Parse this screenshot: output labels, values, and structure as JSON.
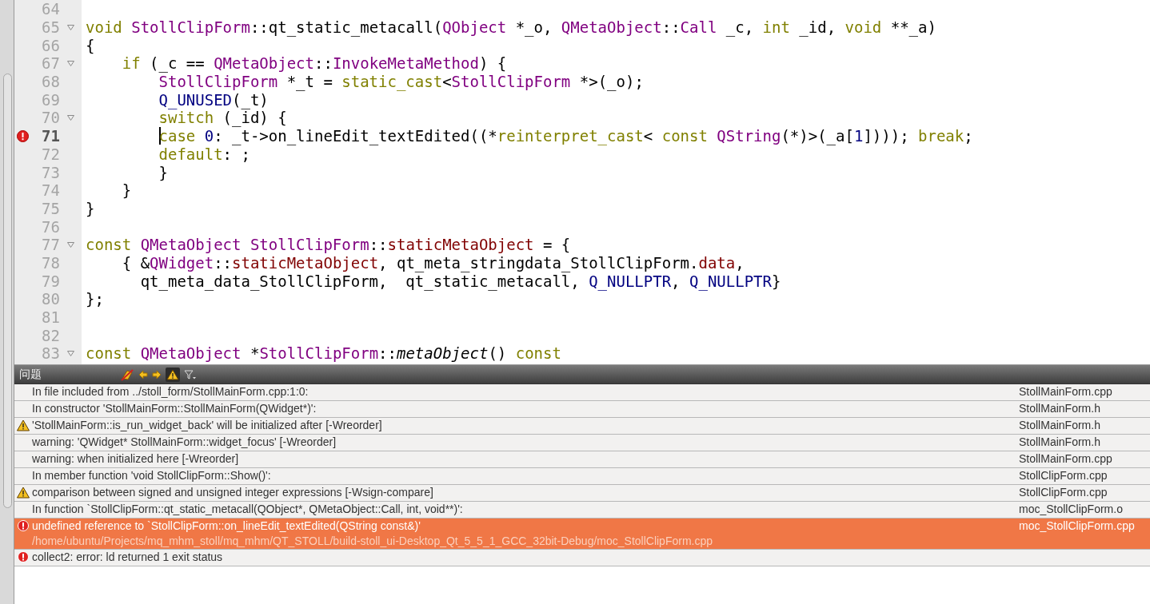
{
  "editor": {
    "lines": [
      {
        "number": "64"
      },
      {
        "number": "65",
        "fold": true,
        "tokens": [
          {
            "kind": "keyword",
            "text": "void "
          },
          {
            "kind": "type",
            "text": "StollClipForm"
          },
          {
            "kind": "plain",
            "text": "::qt_static_metacall("
          },
          {
            "kind": "type",
            "text": "QObject"
          },
          {
            "kind": "plain",
            "text": " *_o, "
          },
          {
            "kind": "type",
            "text": "QMetaObject"
          },
          {
            "kind": "plain",
            "text": "::"
          },
          {
            "kind": "type",
            "text": "Call"
          },
          {
            "kind": "plain",
            "text": " _c, "
          },
          {
            "kind": "keyword",
            "text": "int"
          },
          {
            "kind": "plain",
            "text": " _id, "
          },
          {
            "kind": "keyword",
            "text": "void"
          },
          {
            "kind": "plain",
            "text": " **_a)"
          }
        ]
      },
      {
        "number": "66",
        "tokens": [
          {
            "kind": "plain",
            "text": "{"
          }
        ]
      },
      {
        "number": "67",
        "fold": true,
        "tokens": [
          {
            "kind": "keyword",
            "text": "    if"
          },
          {
            "kind": "plain",
            "text": " (_c == "
          },
          {
            "kind": "type",
            "text": "QMetaObject"
          },
          {
            "kind": "plain",
            "text": "::"
          },
          {
            "kind": "type",
            "text": "InvokeMetaMethod"
          },
          {
            "kind": "plain",
            "text": ") {"
          }
        ]
      },
      {
        "number": "68",
        "tokens": [
          {
            "kind": "type",
            "text": "        StollClipForm"
          },
          {
            "kind": "plain",
            "text": " *_t = "
          },
          {
            "kind": "keyword",
            "text": "static_cast"
          },
          {
            "kind": "plain",
            "text": "<"
          },
          {
            "kind": "type",
            "text": "StollClipForm"
          },
          {
            "kind": "plain",
            "text": " *>(_o);"
          }
        ]
      },
      {
        "number": "69",
        "tokens": [
          {
            "kind": "macro",
            "text": "        Q_UNUSED"
          },
          {
            "kind": "plain",
            "text": "(_t)"
          }
        ]
      },
      {
        "number": "70",
        "fold": true,
        "tokens": [
          {
            "kind": "keyword",
            "text": "        switch"
          },
          {
            "kind": "plain",
            "text": " (_id) {"
          }
        ]
      },
      {
        "number": "71",
        "error": true,
        "current": true,
        "cursor": true,
        "tokens": [
          {
            "kind": "keyword",
            "text": "        case "
          },
          {
            "kind": "macro",
            "text": "0"
          },
          {
            "kind": "plain",
            "text": ": _t->on_lineEdit_textEdited((*"
          },
          {
            "kind": "keyword",
            "text": "reinterpret_cast"
          },
          {
            "kind": "plain",
            "text": "< "
          },
          {
            "kind": "keyword",
            "text": "const "
          },
          {
            "kind": "type",
            "text": "QString"
          },
          {
            "kind": "plain",
            "text": "(*)>(_a["
          },
          {
            "kind": "macro",
            "text": "1"
          },
          {
            "kind": "plain",
            "text": "]))); "
          },
          {
            "kind": "keyword",
            "text": "break"
          },
          {
            "kind": "plain",
            "text": ";"
          }
        ]
      },
      {
        "number": "72",
        "tokens": [
          {
            "kind": "keyword",
            "text": "        default"
          },
          {
            "kind": "plain",
            "text": ": ;"
          }
        ]
      },
      {
        "number": "73",
        "tokens": [
          {
            "kind": "plain",
            "text": "        }"
          }
        ]
      },
      {
        "number": "74",
        "tokens": [
          {
            "kind": "plain",
            "text": "    }"
          }
        ]
      },
      {
        "number": "75",
        "tokens": [
          {
            "kind": "plain",
            "text": "}"
          }
        ]
      },
      {
        "number": "76"
      },
      {
        "number": "77",
        "fold": true,
        "tokens": [
          {
            "kind": "keyword",
            "text": "const "
          },
          {
            "kind": "type",
            "text": "QMetaObject StollClipForm"
          },
          {
            "kind": "plain",
            "text": "::"
          },
          {
            "kind": "field",
            "text": "staticMetaObject"
          },
          {
            "kind": "plain",
            "text": " = {"
          }
        ]
      },
      {
        "number": "78",
        "tokens": [
          {
            "kind": "plain",
            "text": "    { &"
          },
          {
            "kind": "type",
            "text": "QWidget"
          },
          {
            "kind": "plain",
            "text": "::"
          },
          {
            "kind": "field",
            "text": "staticMetaObject"
          },
          {
            "kind": "plain",
            "text": ", qt_meta_stringdata_StollClipForm."
          },
          {
            "kind": "field",
            "text": "data"
          },
          {
            "kind": "plain",
            "text": ","
          }
        ]
      },
      {
        "number": "79",
        "tokens": [
          {
            "kind": "plain",
            "text": "      qt_meta_data_StollClipForm,  qt_static_metacall, "
          },
          {
            "kind": "macro",
            "text": "Q_NULLPTR"
          },
          {
            "kind": "plain",
            "text": ", "
          },
          {
            "kind": "macro",
            "text": "Q_NULLPTR"
          },
          {
            "kind": "plain",
            "text": "}"
          }
        ]
      },
      {
        "number": "80",
        "tokens": [
          {
            "kind": "plain",
            "text": "};"
          }
        ]
      },
      {
        "number": "81"
      },
      {
        "number": "82"
      },
      {
        "number": "83",
        "fold": true,
        "tokens": [
          {
            "kind": "keyword",
            "text": "const "
          },
          {
            "kind": "type",
            "text": "QMetaObject"
          },
          {
            "kind": "plain",
            "text": " *"
          },
          {
            "kind": "type",
            "text": "StollClipForm"
          },
          {
            "kind": "plain",
            "text": "::"
          },
          {
            "kind": "italic",
            "text": "metaObject"
          },
          {
            "kind": "plain",
            "text": "() "
          },
          {
            "kind": "keyword",
            "text": "const"
          }
        ]
      }
    ]
  },
  "problems": {
    "title": "问题",
    "toolbar": [
      {
        "kind": "clear",
        "pressed": false
      },
      {
        "kind": "prev",
        "pressed": false
      },
      {
        "kind": "next",
        "pressed": false
      },
      {
        "kind": "warnings",
        "pressed": true
      },
      {
        "kind": "filter",
        "pressed": false
      }
    ],
    "rows": [
      {
        "kind": "info",
        "text": "In file included from ../stoll_form/StollMainForm.cpp:1:0:",
        "file": "StollMainForm.cpp",
        "selected": false
      },
      {
        "kind": "info",
        "text": "In constructor 'StollMainForm::StollMainForm(QWidget*)':",
        "file": "StollMainForm.h",
        "selected": false
      },
      {
        "kind": "warning",
        "text": "'StollMainForm::is_run_widget_back' will be initialized after [-Wreorder]",
        "file": "StollMainForm.h",
        "selected": false
      },
      {
        "kind": "info",
        "text": "warning:   'QWidget* StollMainForm::widget_focus' [-Wreorder]",
        "file": "StollMainForm.h",
        "selected": false
      },
      {
        "kind": "info",
        "text": "warning:   when initialized here [-Wreorder]",
        "file": "StollMainForm.cpp",
        "selected": false
      },
      {
        "kind": "info",
        "text": "In member function 'void StollClipForm::Show()':",
        "file": "StollClipForm.cpp",
        "selected": false
      },
      {
        "kind": "warning",
        "text": "comparison between signed and unsigned integer expressions [-Wsign-compare]",
        "file": "StollClipForm.cpp",
        "selected": false
      },
      {
        "kind": "info",
        "text": "In function `StollClipForm::qt_static_metacall(QObject*, QMetaObject::Call, int, void**)':",
        "file": "moc_StollClipForm.o",
        "selected": false
      },
      {
        "kind": "error",
        "text": "undefined reference to `StollClipForm::on_lineEdit_textEdited(QString const&)'",
        "path": "/home/ubuntu/Projects/mq_mhm_stoll/mq_mhm/QT_STOLL/build-stoll_ui-Desktop_Qt_5_5_1_GCC_32bit-Debug/moc_StollClipForm.cpp",
        "file": "moc_StollClipForm.cpp",
        "selected": true
      },
      {
        "kind": "error",
        "text": "collect2: error: ld returned 1 exit status",
        "selected": false
      }
    ]
  }
}
